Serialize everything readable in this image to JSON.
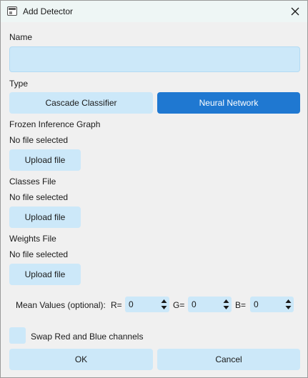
{
  "window": {
    "title": "Add Detector"
  },
  "name": {
    "label": "Name",
    "value": ""
  },
  "type": {
    "label": "Type",
    "options": [
      "Cascade Classifier",
      "Neural Network"
    ],
    "selected": "Neural Network"
  },
  "frozen_graph": {
    "label": "Frozen Inference Graph",
    "status": "No file selected",
    "button": "Upload file"
  },
  "classes_file": {
    "label": "Classes File",
    "status": "No file selected",
    "button": "Upload file"
  },
  "weights_file": {
    "label": "Weights File",
    "status": "No file selected",
    "button": "Upload file"
  },
  "mean_values": {
    "label": "Mean Values (optional):",
    "r_label": "R=",
    "r_value": "0",
    "g_label": "G=",
    "g_value": "0",
    "b_label": "B=",
    "b_value": "0"
  },
  "swap_channels": {
    "label": "Swap Red and Blue channels",
    "checked": false
  },
  "footer": {
    "ok": "OK",
    "cancel": "Cancel"
  },
  "colors": {
    "accent": "#1f78d1",
    "control_bg": "#cce8f9",
    "titlebar_bg": "#eef6f5",
    "window_bg": "#f0f0f0"
  }
}
